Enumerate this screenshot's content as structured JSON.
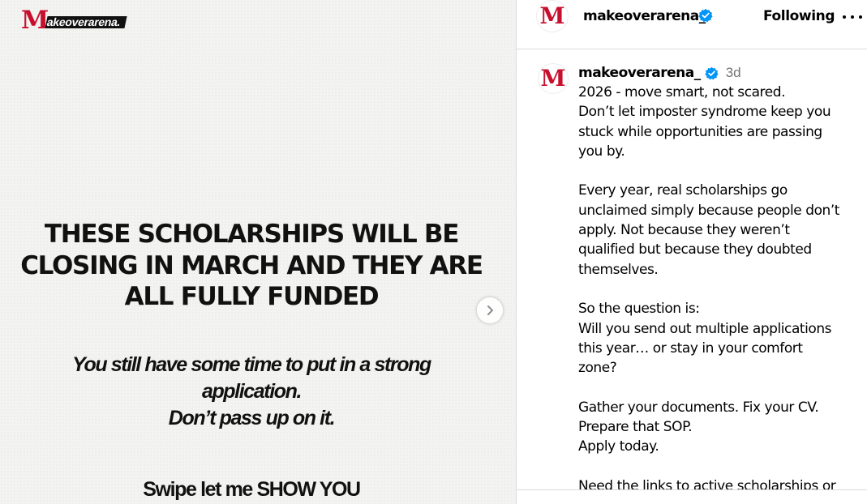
{
  "media": {
    "brand_initial": "M",
    "brand_rest": "akeoverarena.",
    "heading": [
      "THESE SCHOLARSHIPS WILL BE",
      "CLOSING IN MARCH AND THEY ARE",
      "ALL FULLY FUNDED"
    ],
    "subtext": [
      "You still have some time to put in a strong",
      "application.",
      "Don’t pass up on it."
    ],
    "swipe": "Swipe let me SHOW YOU",
    "next_icon": "chevron-right-icon",
    "brand_color": "#c8102e"
  },
  "header": {
    "avatar_letter": "M",
    "username": "makeoverarena_",
    "verified_icon": "verified-badge-icon",
    "follow_status": "Following",
    "more_icon": "more-options-icon"
  },
  "caption": {
    "avatar_letter": "M",
    "username": "makeoverarena_",
    "time": "3d",
    "lines": [
      "2026 - move smart, not scared.",
      "Don’t let imposter syndrome keep you",
      "stuck while opportunities are passing",
      "you by.",
      "",
      "Every year, real scholarships go",
      "unclaimed simply because people don’t",
      "apply. Not because they weren’t",
      "qualified but because they doubted",
      "themselves.",
      "",
      "So the question is:",
      "Will you send out multiple applications",
      "this year… or stay in your comfort",
      "zone?",
      "",
      "Gather your documents. Fix your CV.",
      "Prepare that SOP.",
      "Apply today.",
      "",
      "Need the links to active scholarships or"
    ]
  },
  "colors": {
    "verified": "#0095f6",
    "muted_text": "#737373",
    "divider": "#dbdbdb"
  }
}
